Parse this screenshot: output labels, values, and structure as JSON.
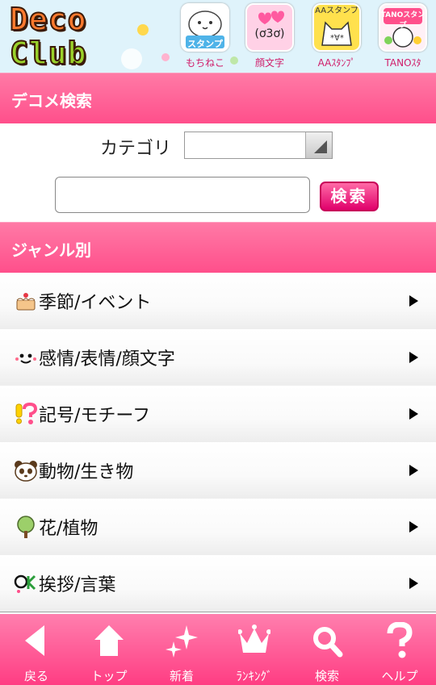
{
  "header": {
    "logo_lines": [
      "Deco",
      "Club"
    ],
    "shortcuts": [
      {
        "label": "もちねこ",
        "thumb_text": "スタンプ",
        "icon": "cat-stamp-icon"
      },
      {
        "label": "顔文字",
        "thumb_text": "(ơ3ơ)",
        "icon": "kaomoji-icon"
      },
      {
        "label": "AAｽﾀﾝﾌﾟ",
        "thumb_text": "AAスタンプ",
        "icon": "aa-stamp-icon"
      },
      {
        "label": "TANOｽﾀ",
        "thumb_text": "TANOスタンプ",
        "icon": "tano-stamp-icon"
      }
    ]
  },
  "search": {
    "title": "デコメ検索",
    "category_label": "カテゴリ",
    "category_value": "",
    "input_value": "",
    "button_label": "検索"
  },
  "genre": {
    "title": "ジャンル別",
    "items": [
      {
        "label": "季節/イベント",
        "icon": "cake-icon"
      },
      {
        "label": "感情/表情/顔文字",
        "icon": "smiley-face-icon"
      },
      {
        "label": "記号/モチーフ",
        "icon": "exclamation-question-icon"
      },
      {
        "label": "動物/生き物",
        "icon": "panda-icon"
      },
      {
        "label": "花/植物",
        "icon": "tree-icon"
      },
      {
        "label": "挨拶/言葉",
        "icon": "ok-icon"
      }
    ]
  },
  "bottom_nav": [
    {
      "label": "戻る",
      "icon": "back-arrow-icon"
    },
    {
      "label": "トップ",
      "icon": "home-icon"
    },
    {
      "label": "新着",
      "icon": "sparkle-icon"
    },
    {
      "label": "ﾗﾝｷﾝｸﾞ",
      "icon": "crown-icon"
    },
    {
      "label": "検索",
      "icon": "magnifier-icon"
    },
    {
      "label": "ヘルプ",
      "icon": "question-mark-icon"
    }
  ],
  "colors": {
    "accent_pink": "#ff4f8b",
    "nav_pink": "#ff3d83",
    "header_bg": "#dff3fb"
  }
}
